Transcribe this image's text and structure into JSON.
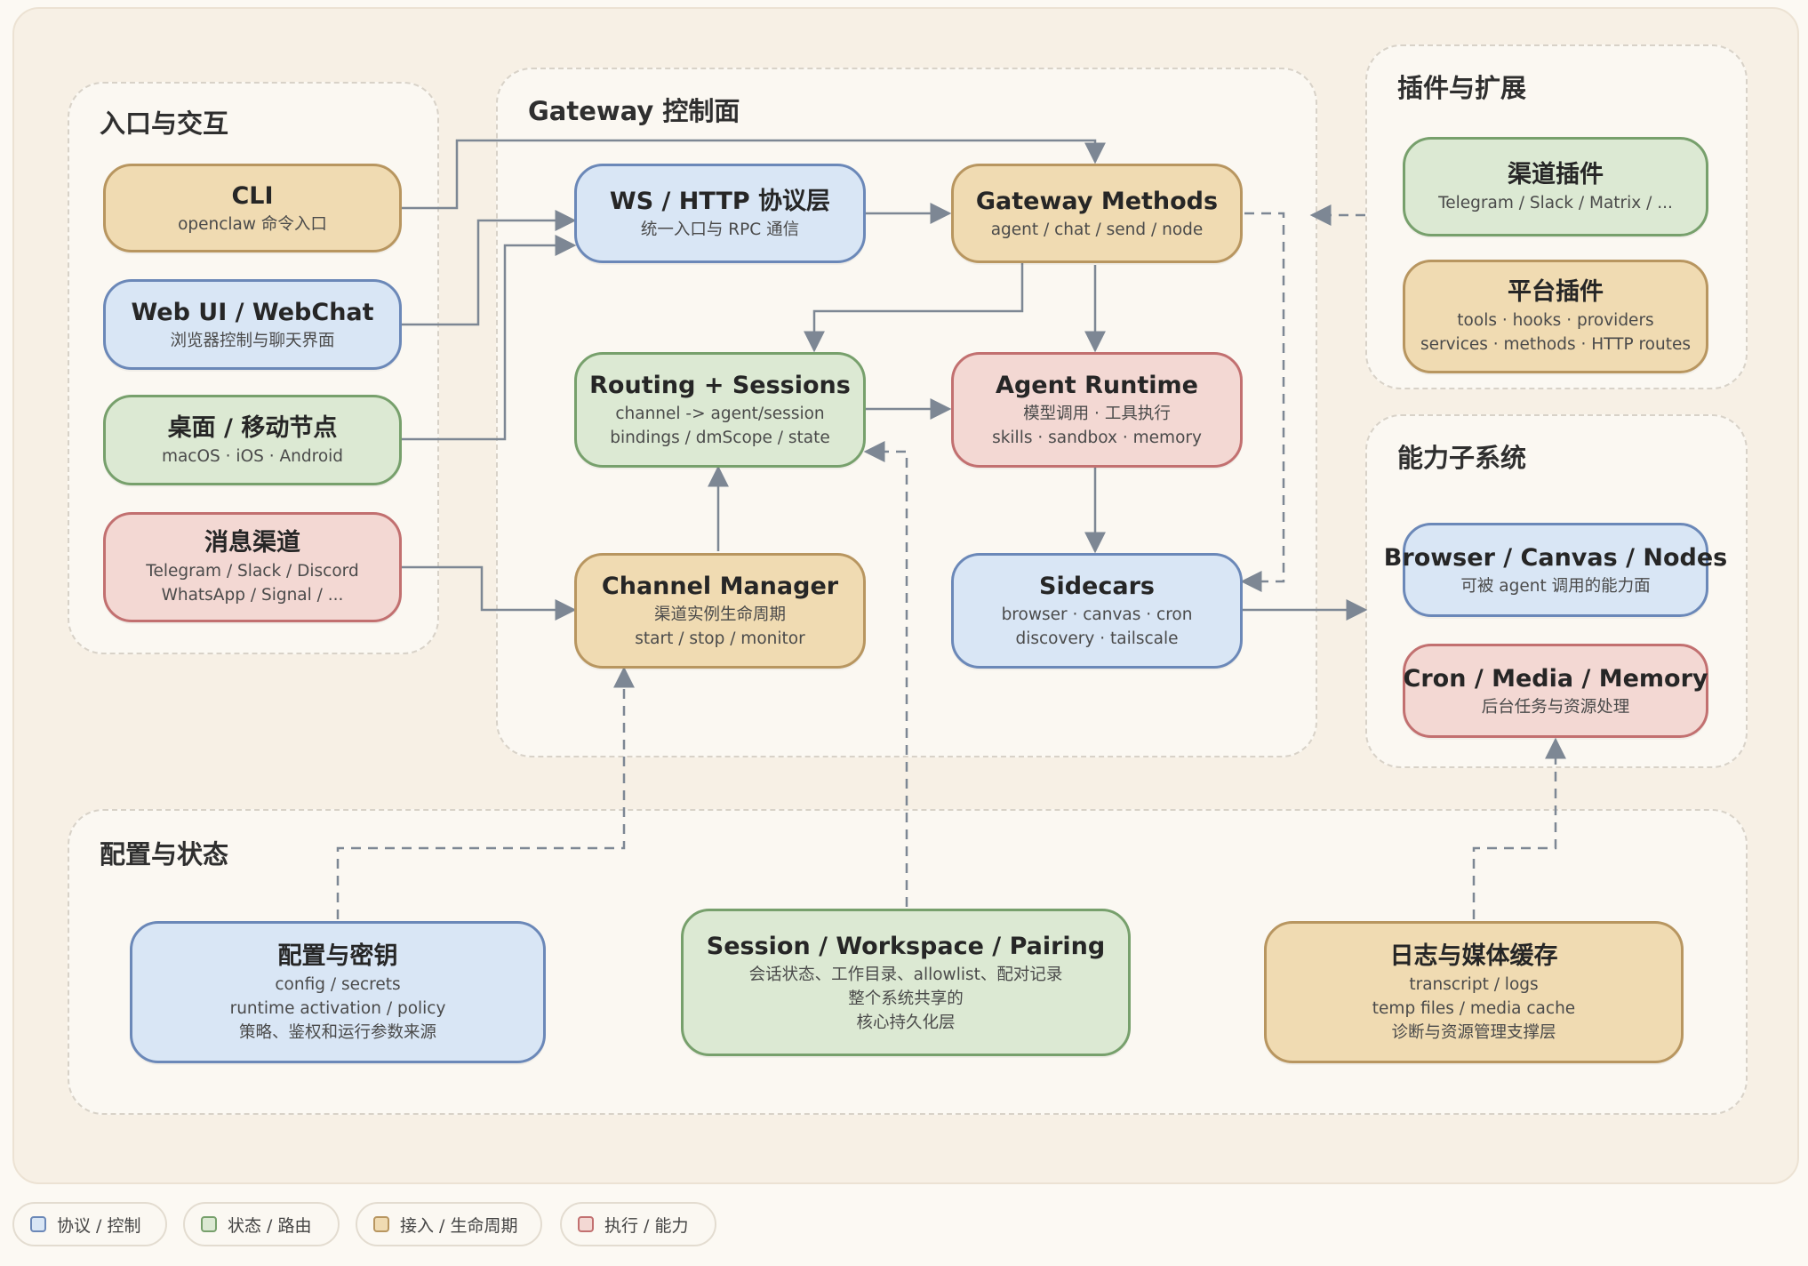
{
  "groups": {
    "entry": "入口与交互",
    "gateway": "Gateway 控制面",
    "plugins": "插件与扩展",
    "capability": "能力子系统",
    "config": "配置与状态"
  },
  "nodes": {
    "cli": {
      "title": "CLI",
      "lines": [
        "openclaw 命令入口"
      ]
    },
    "webui": {
      "title": "Web UI / WebChat",
      "lines": [
        "浏览器控制与聊天界面"
      ]
    },
    "desktop": {
      "title": "桌面 / 移动节点",
      "lines": [
        "macOS · iOS · Android"
      ]
    },
    "channels": {
      "title": "消息渠道",
      "lines": [
        "Telegram / Slack / Discord",
        "WhatsApp / Signal / ..."
      ]
    },
    "ws": {
      "title": "WS / HTTP 协议层",
      "lines": [
        "统一入口与 RPC 通信"
      ]
    },
    "methods": {
      "title": "Gateway Methods",
      "lines": [
        "agent / chat / send / node"
      ]
    },
    "routing": {
      "title": "Routing + Sessions",
      "lines": [
        "channel -> agent/session",
        "bindings / dmScope / state"
      ]
    },
    "agent": {
      "title": "Agent Runtime",
      "lines": [
        "模型调用 · 工具执行",
        "skills · sandbox · memory"
      ]
    },
    "chanmgr": {
      "title": "Channel Manager",
      "lines": [
        "渠道实例生命周期",
        "start / stop / monitor"
      ]
    },
    "sidecars": {
      "title": "Sidecars",
      "lines": [
        "browser · canvas · cron",
        "discovery · tailscale"
      ]
    },
    "chplugin": {
      "title": "渠道插件",
      "lines": [
        "Telegram / Slack / Matrix / ..."
      ]
    },
    "platplugin": {
      "title": "平台插件",
      "lines": [
        "tools · hooks · providers",
        "services · methods · HTTP routes"
      ]
    },
    "browser": {
      "title": "Browser / Canvas / Nodes",
      "lines": [
        "可被 agent 调用的能力面"
      ]
    },
    "cron": {
      "title": "Cron / Media / Memory",
      "lines": [
        "后台任务与资源处理"
      ]
    },
    "secrets": {
      "title": "配置与密钥",
      "lines": [
        "config / secrets",
        "runtime activation / policy",
        "策略、鉴权和运行参数来源"
      ]
    },
    "session": {
      "title": "Session / Workspace / Pairing",
      "lines": [
        "会话状态、工作目录、allowlist、配对记录",
        "整个系统共享的",
        "核心持久化层"
      ]
    },
    "logs": {
      "title": "日志与媒体缓存",
      "lines": [
        "transcript / logs",
        "temp files / media cache",
        "诊断与资源管理支撑层"
      ]
    }
  },
  "legend": [
    {
      "label": "协议 / 控制",
      "fill": "#d9e6f5",
      "stroke": "#6b88b8"
    },
    {
      "label": "状态 / 路由",
      "fill": "#dce9d3",
      "stroke": "#77a06c"
    },
    {
      "label": "接入 / 生命周期",
      "fill": "#f0dbb2",
      "stroke": "#b89660"
    },
    {
      "label": "执行 / 能力",
      "fill": "#f3d8d3",
      "stroke": "#c27070"
    }
  ],
  "colors": {
    "protocol": "#d9e6f5",
    "state": "#dce9d3",
    "lifecycle": "#f0dbb2",
    "execution": "#f3d8d3",
    "connector": "#7d8794"
  }
}
